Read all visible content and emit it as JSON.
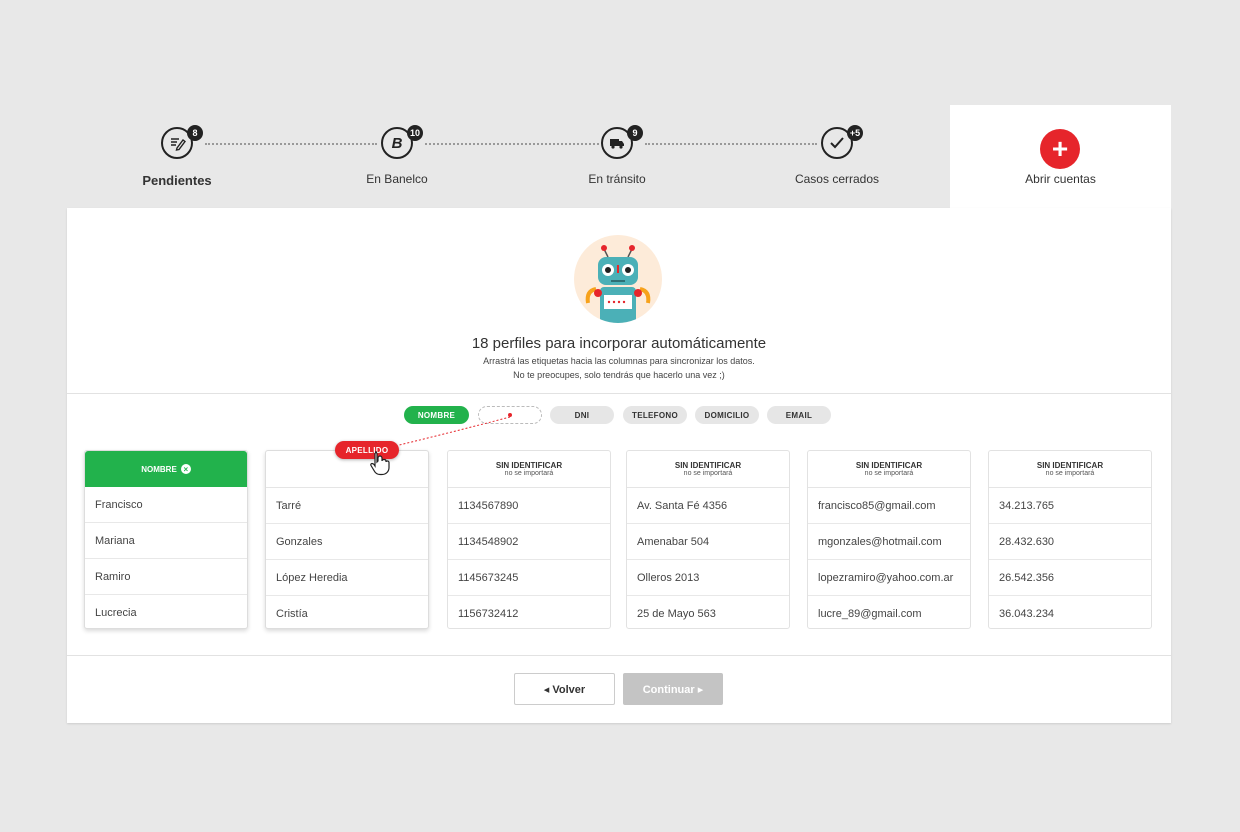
{
  "tabs": [
    {
      "label": "Pendientes",
      "badge": "8",
      "icon": "edit-list-icon",
      "bold": true
    },
    {
      "label": "En Banelco",
      "badge": "10",
      "icon": "banelco-icon",
      "glyph": "B"
    },
    {
      "label": "En tránsito",
      "badge": "9",
      "icon": "truck-icon"
    },
    {
      "label": "Casos cerrados",
      "badge": "+5",
      "icon": "check-icon"
    }
  ],
  "active_tab": {
    "label": "Abrir cuentas",
    "icon": "plus-icon",
    "glyph": "+"
  },
  "intro": {
    "headline": "18 perfiles para incorporar automáticamente",
    "line1": "Arrastrá las etiquetas hacia las columnas para sincronizar los datos.",
    "line2": "No te preocupes, solo tendrás que hacerlo una vez ;)"
  },
  "tags": {
    "nombre": "NOMBRE",
    "dni": "DNI",
    "telefono": "TELEFONO",
    "domicilio": "DOMICILIO",
    "email": "EMAIL",
    "dragging": "APELLIDO"
  },
  "columns": [
    {
      "title": "NOMBRE",
      "subtitle": "",
      "rows": [
        "Francisco",
        "Mariana",
        "Ramiro",
        "Lucrecia"
      ]
    },
    {
      "title": "",
      "subtitle": "",
      "rows": [
        "Tarré",
        "Gonzales",
        "López Heredia",
        "Cristía"
      ]
    },
    {
      "title": "SIN IDENTIFICAR",
      "subtitle": "no se importará",
      "rows": [
        "1134567890",
        "1134548902",
        "1145673245",
        "1156732412"
      ]
    },
    {
      "title": "SIN IDENTIFICAR",
      "subtitle": "no se importará",
      "rows": [
        "Av. Santa Fé 4356",
        "Amenabar 504",
        "Olleros 2013",
        "25 de Mayo 563"
      ]
    },
    {
      "title": "SIN IDENTIFICAR",
      "subtitle": "no se importará",
      "rows": [
        "francisco85@gmail.com",
        "mgonzales@hotmail.com",
        "lopezramiro@yahoo.com.ar",
        "lucre_89@gmail.com"
      ]
    },
    {
      "title": "SIN IDENTIFICAR",
      "subtitle": "no se importará",
      "rows": [
        "34.213.765",
        "28.432.630",
        "26.542.356",
        "36.043.234"
      ]
    }
  ],
  "buttons": {
    "back": "◂  Volver",
    "next": "Continuar  ▸"
  },
  "colors": {
    "green": "#22b24c",
    "red": "#e6252b",
    "disabled": "#c4c4c4"
  }
}
